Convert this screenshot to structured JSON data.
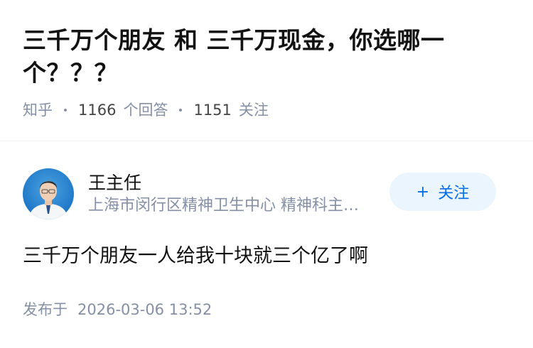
{
  "question": {
    "title": "三千万个朋友 和 三千万现金，你选哪一个？？？",
    "source": "知乎",
    "answer_count": "1166",
    "answer_label": "个回答",
    "follower_count": "1151",
    "follower_label": "关注"
  },
  "answer": {
    "author_name": "王主任",
    "author_bio": "上海市闵行区精神卫生中心 精神科主任医师",
    "follow_button_label": "关注",
    "follow_button_icon": "plus-icon",
    "content": "三千万个朋友一人给我十块就三个亿了啊",
    "published_label": "发布于",
    "published_time": "2026-03-06 13:52"
  },
  "colors": {
    "accent": "#056de8",
    "button_bg": "#ebf5fd",
    "meta_text": "#8590a6",
    "primary_text": "#121212",
    "avatar_bg": "#1f78c8"
  }
}
